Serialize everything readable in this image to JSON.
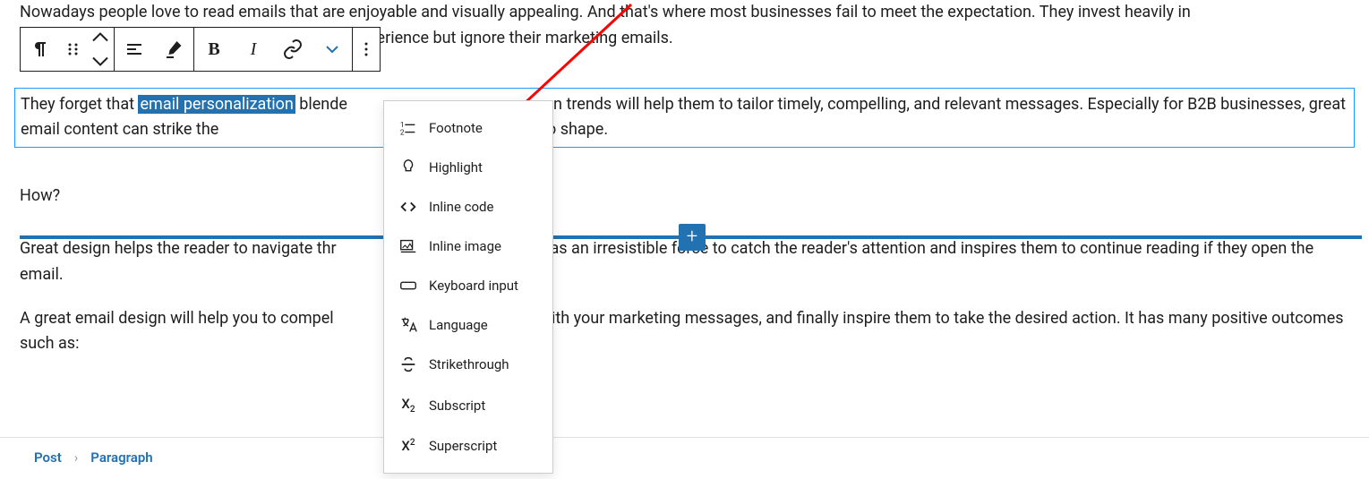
{
  "paragraphs": {
    "p1_a": "Nowadays people love to read emails that are enjoyable and visually appealing. And that's where most businesses fail to meet the expectation. They invest heavily in",
    "p1_b": "perience but ignore their marketing emails.",
    "p2_a": "They forget that ",
    "p2_sel": "email personalization",
    "p2_b": " blende",
    "p2_c": "gn trends will help them to tailor timely, compelling, and relevant messages. Especially for B2B businesses, great email content can strike the",
    "p2_d": "design makes it hot to shape.",
    "p3": "How?",
    "p4a": "Great design helps the reader to navigate thr",
    "p4b": "acts as an irresistible force to catch the reader's attention and inspires them to continue reading if they open the email.",
    "p5a": "A great email design will help you to compel",
    "p5b": "em with your marketing messages, and finally inspire them to take the desired action. It has many positive outcomes such as:"
  },
  "dropdown": {
    "items": [
      {
        "label": "Footnote"
      },
      {
        "label": "Highlight"
      },
      {
        "label": "Inline code"
      },
      {
        "label": "Inline image"
      },
      {
        "label": "Keyboard input"
      },
      {
        "label": "Language"
      },
      {
        "label": "Strikethrough"
      },
      {
        "label": "Subscript"
      },
      {
        "label": "Superscript"
      }
    ]
  },
  "breadcrumbs": {
    "root": "Post",
    "current": "Paragraph"
  },
  "toolbar": {
    "bold": "B",
    "italic": "I"
  }
}
